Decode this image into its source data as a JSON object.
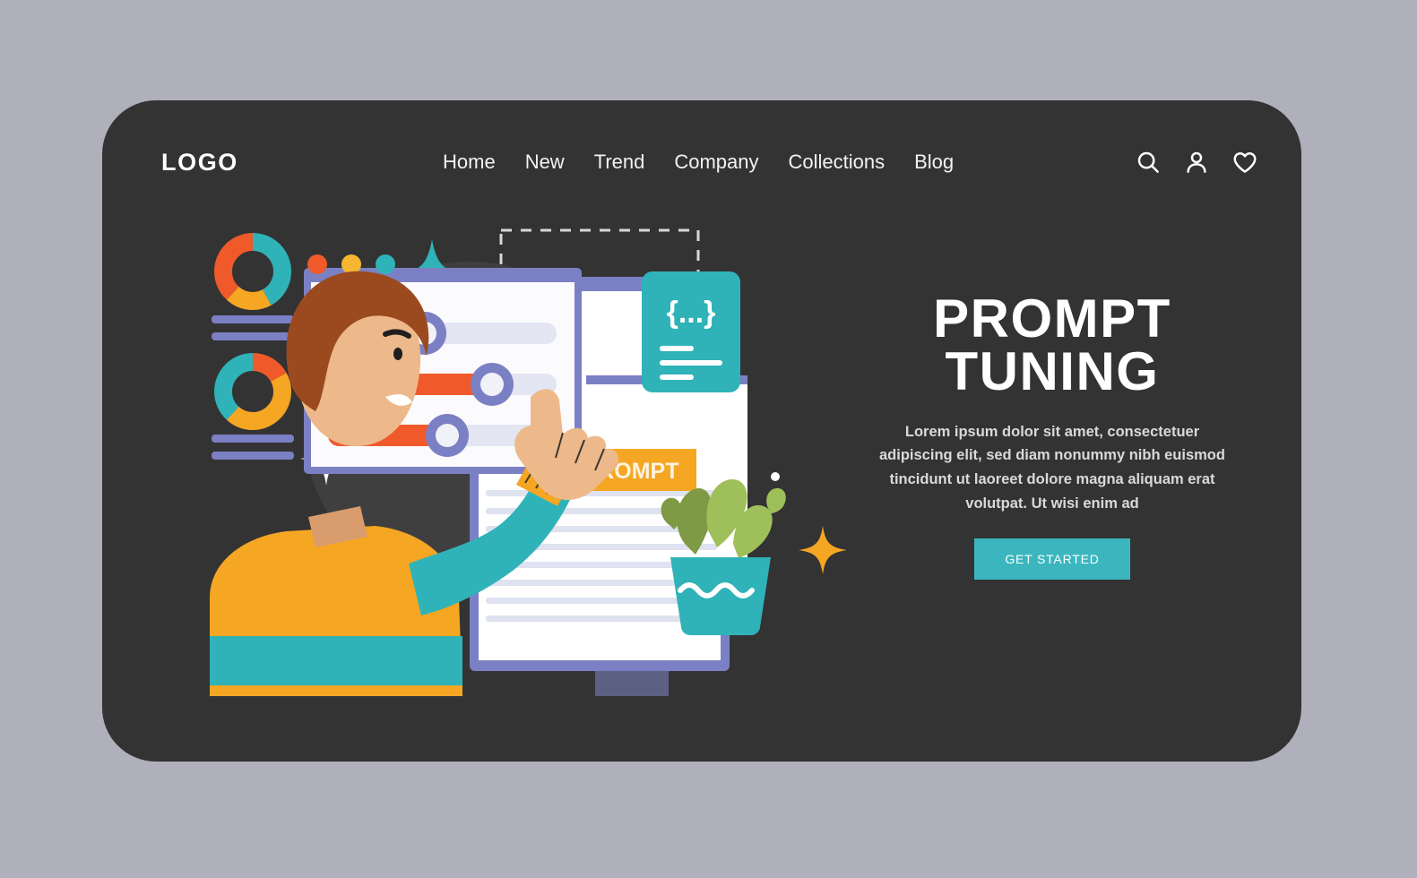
{
  "page": {
    "background_color": "#b0b0bc",
    "card_color": "#333333"
  },
  "header": {
    "logo": "LOGO",
    "nav": [
      {
        "label": "Home"
      },
      {
        "label": "New"
      },
      {
        "label": "Trend"
      },
      {
        "label": "Company"
      },
      {
        "label": "Collections"
      },
      {
        "label": "Blog"
      }
    ],
    "icons": [
      {
        "name": "search-icon"
      },
      {
        "name": "user-icon"
      },
      {
        "name": "heart-icon"
      }
    ]
  },
  "hero": {
    "title_line1": "PROMPT",
    "title_line2": "TUNING",
    "paragraph": "Lorem ipsum dolor sit amet, consectetuer adipiscing elit, sed diam nonummy nibh euismod tincidunt ut laoreet dolore magna aliquam erat volutpat. Ut wisi enim ad",
    "cta_label": "GET STARTED",
    "cta_color": "#3bb6bf"
  },
  "illustration": {
    "prompt_badge": "PROMPT",
    "code_card_symbol": "{...}",
    "window_dots": [
      "#f05a2b",
      "#f5b731",
      "#2fb3b8"
    ],
    "colors": {
      "orange": "#f05a2b",
      "amber": "#f5a623",
      "teal": "#2fb3b8",
      "purple": "#7b80c4",
      "screen": "#ffffff",
      "track": "#e3e5f2",
      "skin": "#edb98a",
      "hair": "#9b4a20",
      "leaf": "#9ebf5a"
    },
    "sliders": [
      {
        "name": "slider-1",
        "fill_percent": 42
      },
      {
        "name": "slider-2",
        "fill_percent": 72
      },
      {
        "name": "slider-3",
        "fill_percent": 52
      }
    ],
    "donuts": [
      {
        "name": "donut-chart-top",
        "segments": [
          {
            "color": "#2fb3b8",
            "value": 42
          },
          {
            "color": "#f5a623",
            "value": 20
          },
          {
            "color": "#f05a2b",
            "value": 38
          }
        ]
      },
      {
        "name": "donut-chart-bottom",
        "segments": [
          {
            "color": "#f5a623",
            "value": 45
          },
          {
            "color": "#f05a2b",
            "value": 17
          },
          {
            "color": "#2fb3b8",
            "value": 38
          }
        ]
      }
    ]
  }
}
